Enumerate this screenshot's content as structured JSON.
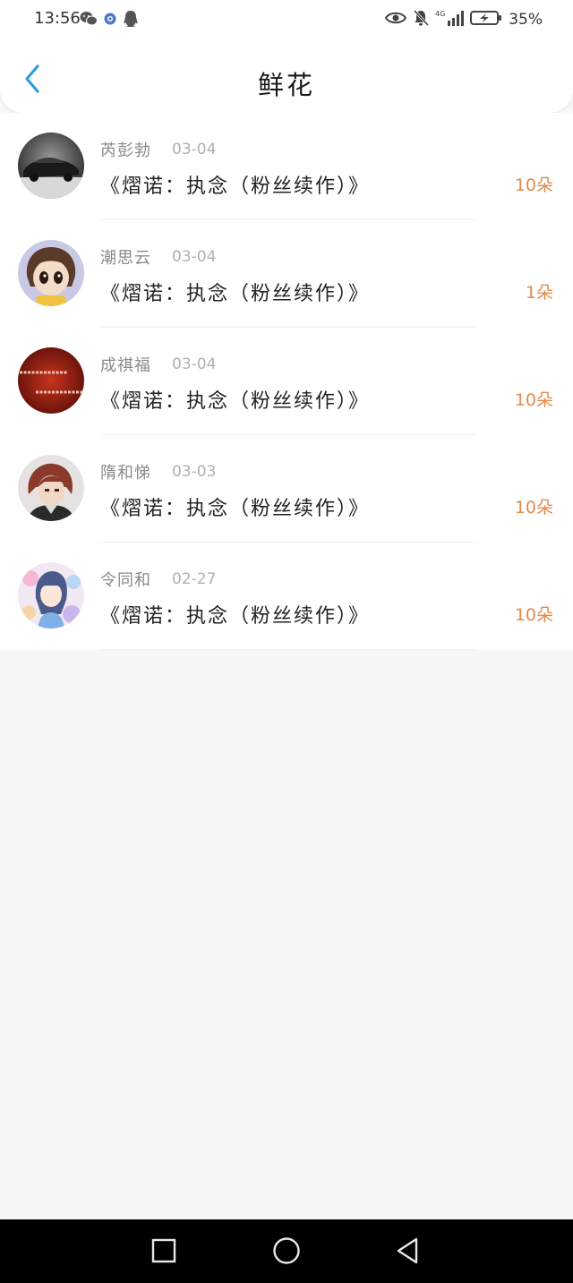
{
  "status_bar": {
    "time": "13:56",
    "battery_pct": "35%",
    "left_icons": [
      "wechat-icon",
      "browser-icon",
      "qq-icon"
    ],
    "right_icons": [
      "eye-icon",
      "mute-bell-icon",
      "signal-4g-icon",
      "battery-icon"
    ]
  },
  "nav": {
    "title": "鲜花",
    "back_icon": "chevron-left-icon",
    "accent_color": "#2d9ee0"
  },
  "rows": [
    {
      "name": "芮彭勃",
      "date": "03-04",
      "book": "《熠诺：执念（粉丝续作）》",
      "count": "10朵",
      "avatar": "avatar-car"
    },
    {
      "name": "潮思云",
      "date": "03-04",
      "book": "《熠诺：执念（粉丝续作）》",
      "count": "1朵",
      "avatar": "avatar-anime-girl"
    },
    {
      "name": "成祺福",
      "date": "03-04",
      "book": "《熠诺：执念（粉丝续作）》",
      "count": "10朵",
      "avatar": "avatar-red-text"
    },
    {
      "name": "隋和悌",
      "date": "03-03",
      "book": "《熠诺：执念（粉丝续作）》",
      "count": "10朵",
      "avatar": "avatar-anime-boy"
    },
    {
      "name": "令同和",
      "date": "02-27",
      "book": "《熠诺：执念（粉丝续作）》",
      "count": "10朵",
      "avatar": "avatar-colorful-girl"
    }
  ],
  "colors": {
    "count": "#e48a4c",
    "background": "#f8f6f7"
  },
  "system_nav": {
    "icons": [
      "recent-apps-icon",
      "home-icon",
      "back-triangle-icon"
    ]
  }
}
